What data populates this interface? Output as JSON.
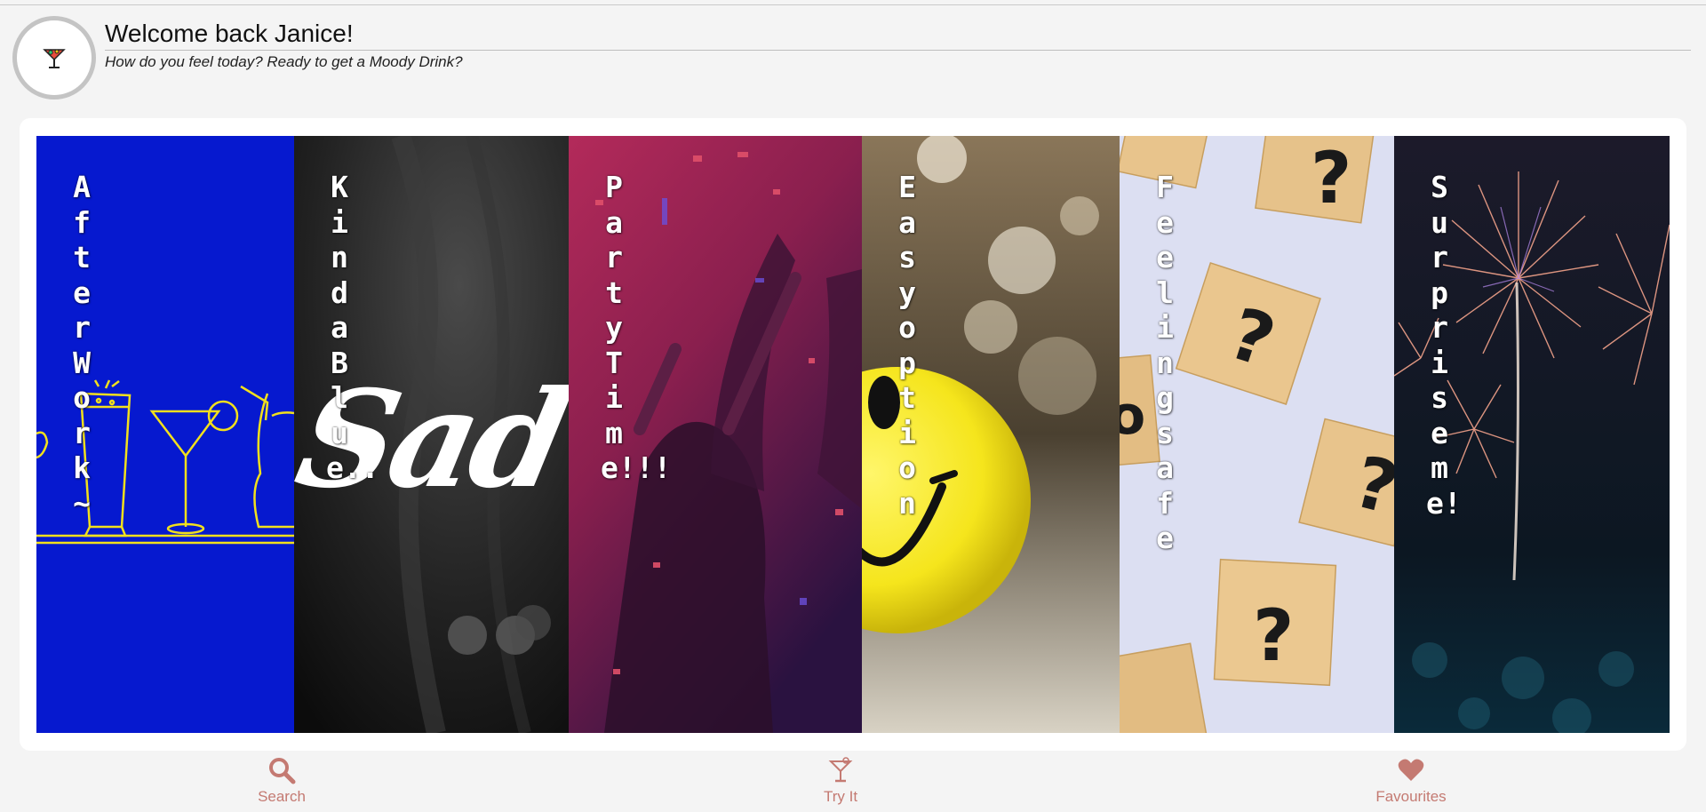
{
  "header": {
    "welcome": "Welcome back Janice!",
    "subtitle": "How do you feel today? Ready to get a Moody Drink?"
  },
  "moods": [
    {
      "label": "After Work~",
      "bg": "#0619cf"
    },
    {
      "label": "Kinda Blue..",
      "bg": "#1a1a1a",
      "overlay_text": "Sad"
    },
    {
      "label": "Party Time!!!",
      "bg": "#7a1e45"
    },
    {
      "label": "Easy option",
      "bg": "#6b5a3e"
    },
    {
      "label": "Feeling safe",
      "bg": "#dcdff2"
    },
    {
      "label": "Surprise me!",
      "bg": "#0f1a2e"
    }
  ],
  "nav": {
    "search": "Search",
    "try_it": "Try It",
    "favourites": "Favourites"
  },
  "colors": {
    "accent": "#c47a72",
    "after_work_line": "#f2e01c"
  },
  "icons": {
    "search": "search-icon",
    "try_it": "cocktail-icon",
    "favourites": "heart-icon"
  }
}
